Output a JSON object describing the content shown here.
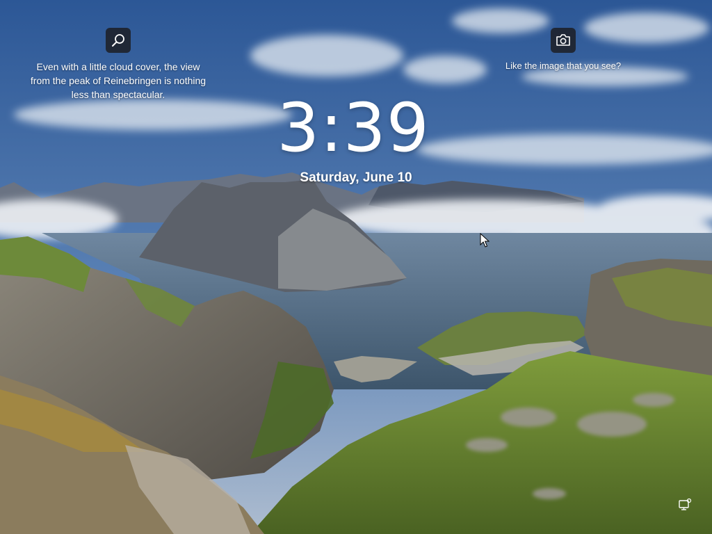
{
  "lockscreen": {
    "time": "3:39",
    "date": "Saturday, June 10"
  },
  "info": {
    "caption": "Even with a little cloud cover, the view from the peak of Reinebringen is nothing less than spectacular.",
    "icon": "search-icon"
  },
  "like": {
    "caption": "Like the image that you see?",
    "icon": "camera-icon"
  },
  "status": {
    "network_icon": "network-icon"
  },
  "colors": {
    "sky_top": "#2c5796",
    "sky_horizon": "#aebdd0",
    "cloud": "#e7edf3",
    "water": "#4f6b86",
    "grass": "#6f8d36",
    "rock": "#7d786c",
    "icon_bg": "#1c1c20"
  }
}
